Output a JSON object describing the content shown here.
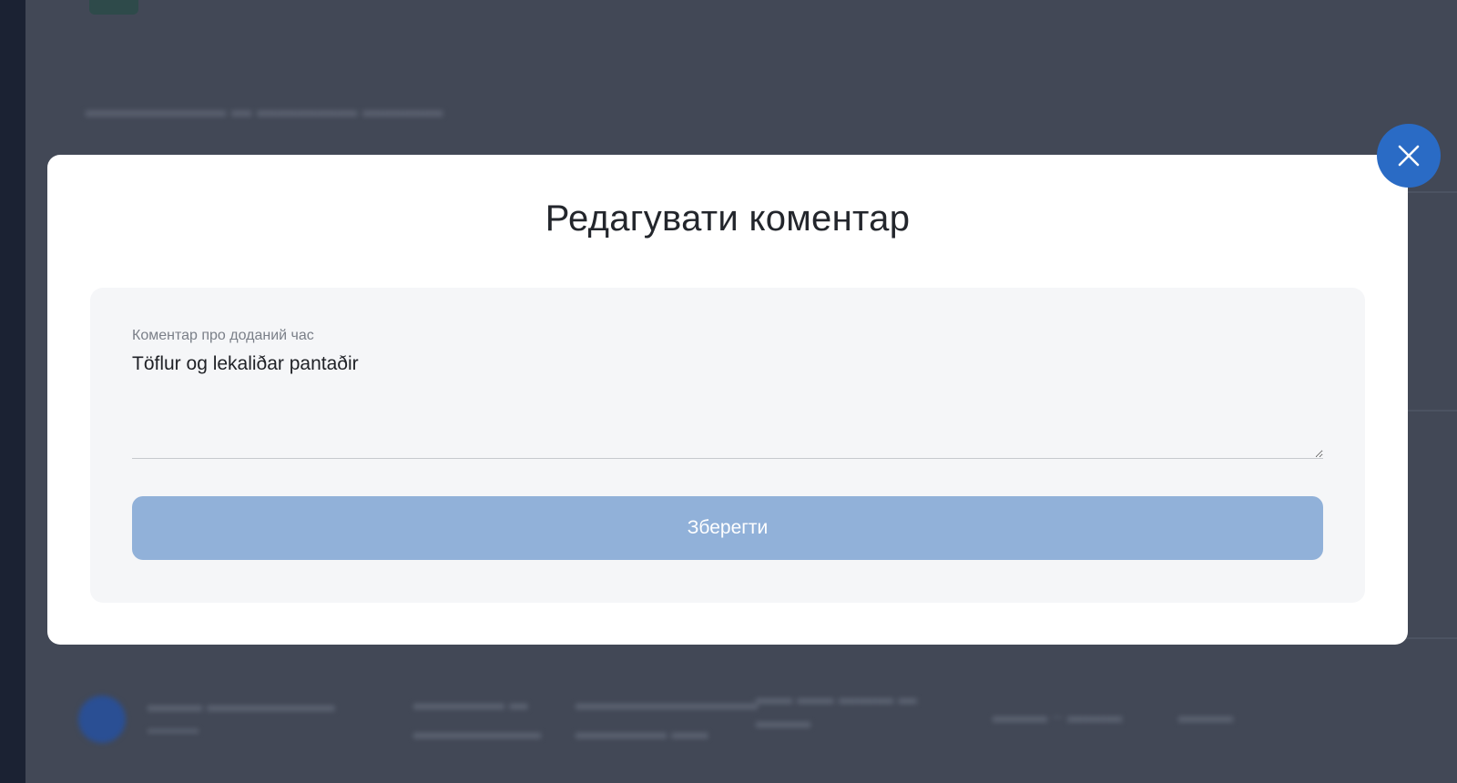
{
  "modal": {
    "title": "Редагувати коментар",
    "comment_label": "Коментар про доданий час",
    "comment_value": "Töflur og lekaliðar pantaðir",
    "save_label": "Зберегти"
  },
  "colors": {
    "overlay": "#424856",
    "modal_background": "#ffffff",
    "panel_background": "#f5f6f8",
    "save_button": "#91b1d9",
    "close_button": "#2a6bc5"
  },
  "icons": {
    "close": "close-icon"
  }
}
